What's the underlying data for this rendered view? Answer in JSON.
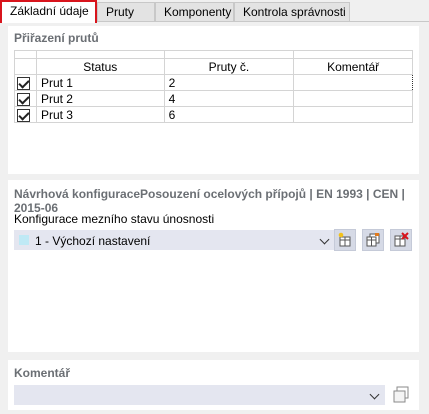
{
  "tabs": [
    {
      "label": "Základní údaje",
      "active": true
    },
    {
      "label": "Pruty",
      "active": false
    },
    {
      "label": "Komponenty",
      "active": false
    },
    {
      "label": "Kontrola správnosti",
      "active": false
    }
  ],
  "assignment": {
    "title": "Přiřazení prutů",
    "columns": {
      "status": "Status",
      "member_no": "Pruty č.",
      "comment": "Komentář"
    },
    "rows": [
      {
        "checked": true,
        "status": "Prut 1",
        "member_no": "2",
        "comment": ""
      },
      {
        "checked": true,
        "status": "Prut 2",
        "member_no": "4",
        "comment": ""
      },
      {
        "checked": true,
        "status": "Prut 3",
        "member_no": "6",
        "comment": ""
      }
    ]
  },
  "design": {
    "title": "Návrhová konfiguracePosouzení ocelových přípojů | EN 1993 | CEN | 2015-06",
    "uls_label": "Konfigurace mezního stavu únosnosti",
    "uls_value": "1 - Výchozí nastavení",
    "uls_swatch_color": "#bfe9f5"
  },
  "comment": {
    "title": "Komentář",
    "value": ""
  },
  "colors": {
    "active_tab_border": "#d8141c",
    "section_title": "#6b6f74",
    "combo_bg": "#e4e6f0"
  }
}
